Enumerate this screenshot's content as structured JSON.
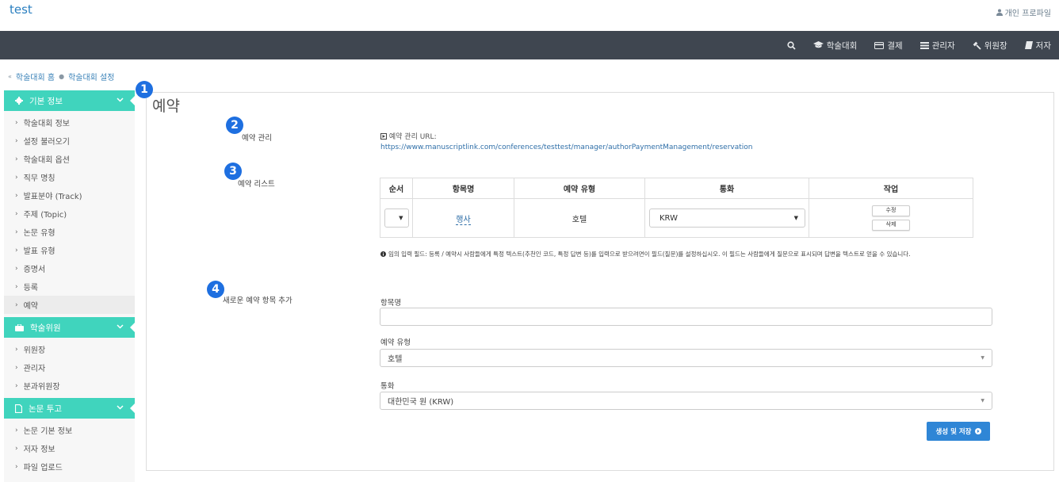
{
  "app": {
    "brand": "test",
    "profile_label": "개인 프로파일"
  },
  "navbar": {
    "items": [
      {
        "label": "",
        "icon": "search-icon"
      },
      {
        "label": "학술대회",
        "icon": "graduation-cap-icon"
      },
      {
        "label": "결제",
        "icon": "credit-card-icon"
      },
      {
        "label": "관리자",
        "icon": "list-icon"
      },
      {
        "label": "위원장",
        "icon": "gavel-icon"
      },
      {
        "label": "저자",
        "icon": "book-icon"
      }
    ]
  },
  "breadcrumb": {
    "home": "학술대회 홈",
    "current": "학술대회 설정"
  },
  "sidebar": {
    "sections": [
      {
        "title": "기본 정보",
        "icon": "gear-icon",
        "items": [
          "학술대회 정보",
          "설정 불러오기",
          "학술대회 옵션",
          "직무 명칭",
          "발표분야 (Track)",
          "주제 (Topic)",
          "논문 유형",
          "발표 유형",
          "증명서",
          "등록",
          "예약"
        ]
      },
      {
        "title": "학술위원",
        "icon": "briefcase-icon",
        "items": [
          "위원장",
          "관리자",
          "분과위원장"
        ]
      },
      {
        "title": "논문 투고",
        "icon": "file-icon",
        "items": [
          "논문 기본 정보",
          "저자 정보",
          "파일 업로드"
        ]
      }
    ],
    "active_item": "예약"
  },
  "badges": [
    "1",
    "2",
    "3",
    "4"
  ],
  "main": {
    "title": "예약",
    "section_manage": "예약 관리",
    "section_list": "예약 리스트",
    "section_add": "새로운 예약 항목 추가",
    "url_label": "예약 관리 URL:",
    "url": "https://www.manuscriptlink.com/conferences/testtest/manager/authorPaymentManagement/reservation",
    "table": {
      "headers": [
        "순서",
        "항목명",
        "예약 유형",
        "통화",
        "작업"
      ],
      "rows": [
        {
          "name": "행사",
          "type": "호텔",
          "currency": "KRW",
          "edit": "수정",
          "delete": "삭제"
        }
      ]
    },
    "note": "임의 입력 필드: 등록 / 예약시 사람들에게 특정 텍스트(추천인 코드, 특정 답변 등)를 입력으로 받으려면이 필드(질문)를 설정하십시오. 이 필드는 사람들에게 질문으로 표시되며 답변을 텍스트로 얻을 수 있습니다.",
    "form": {
      "name_label": "항목명",
      "name_value": "",
      "type_label": "예약 유형",
      "type_value": "호텔",
      "currency_label": "통화",
      "currency_value": "대한민국 원 (KRW)",
      "submit_label": "생성 및 저장"
    }
  },
  "colors": {
    "accent": "#40d4bd",
    "navbar": "#3f4650",
    "primary": "#2f86d6",
    "badge": "#1e6fe0",
    "link": "#2f6fa8"
  }
}
